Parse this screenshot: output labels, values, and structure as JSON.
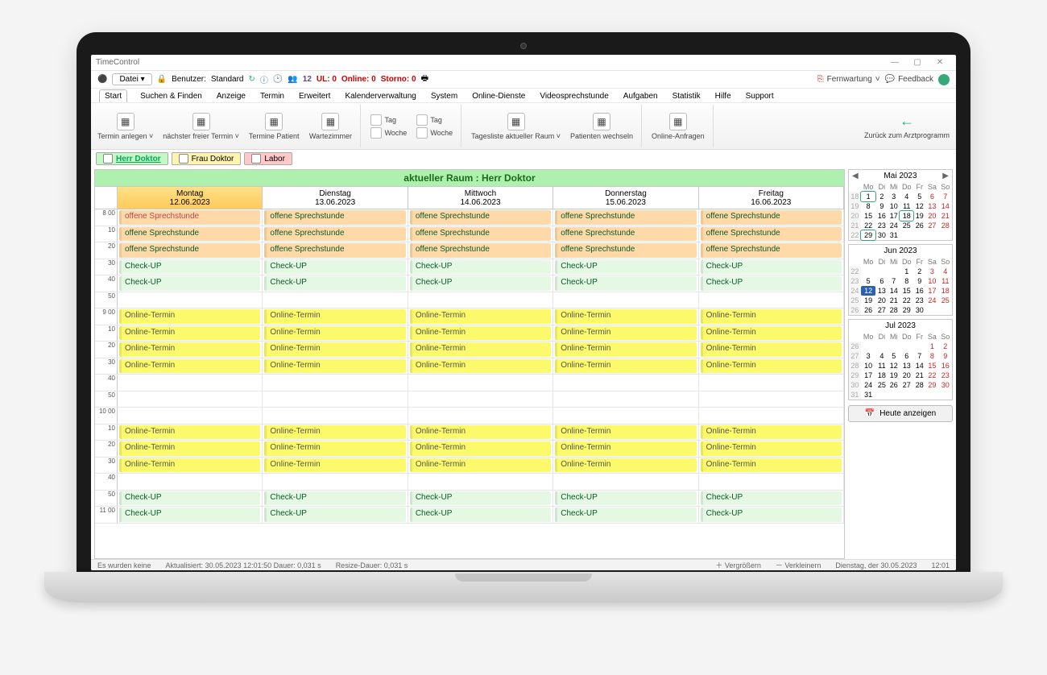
{
  "window": {
    "title": "TimeControl",
    "min": "—",
    "max": "▢",
    "close": "✕"
  },
  "toolbar1": {
    "datei": "Datei ▾",
    "benutzer_label": "Benutzer:",
    "benutzer_value": "Standard",
    "count": "12",
    "ul": "UL: 0",
    "online": "Online: 0",
    "storno": "Storno: 0",
    "fernwartung": "Fernwartung",
    "feedback": "Feedback"
  },
  "menubar": [
    "Start",
    "Suchen & Finden",
    "Anzeige",
    "Termin",
    "Erweitert",
    "Kalenderverwaltung",
    "System",
    "Online-Dienste",
    "Videosprechstunde",
    "Aufgaben",
    "Statistik",
    "Hilfe",
    "Support"
  ],
  "ribbon": {
    "g1": [
      {
        "label": "Termin anlegen",
        "chev": "˅"
      },
      {
        "label": "nächster freier Termin",
        "chev": "˅"
      },
      {
        "label": "Termine Patient"
      },
      {
        "label": "Wartezimmer"
      }
    ],
    "g2rows": [
      "Tag",
      "Woche",
      "Tag",
      "Woche"
    ],
    "g3": [
      {
        "label": "Tagesliste aktueller Raum",
        "chev": "˅"
      },
      {
        "label": "Patienten wechseln"
      }
    ],
    "g4": [
      {
        "label": "Online-Anfragen"
      }
    ],
    "back": "Zurück zum Arztprogramm"
  },
  "rooms": [
    {
      "label": "Herr Doktor",
      "cls": "r-herr"
    },
    {
      "label": "Frau Doktor",
      "cls": "r-frau"
    },
    {
      "label": "Labor",
      "cls": "r-labor"
    }
  ],
  "sched": {
    "header": "aktueller Raum : Herr Doktor",
    "days": [
      {
        "name": "Montag",
        "date": "12.06.2023"
      },
      {
        "name": "Dienstag",
        "date": "13.06.2023"
      },
      {
        "name": "Mittwoch",
        "date": "14.06.2023"
      },
      {
        "name": "Donnerstag",
        "date": "15.06.2023"
      },
      {
        "name": "Freitag",
        "date": "16.06.2023"
      }
    ],
    "rows": [
      {
        "t": "8 00",
        "apts": [
          "offene Sprechstunde",
          "offene Sprechstunde",
          "offene Sprechstunde",
          "offene Sprechstunde",
          "offene Sprechstunde"
        ],
        "firstSpecial": true,
        "cls": "offen2"
      },
      {
        "t": "10",
        "apts": [
          "offene Sprechstunde",
          "offene Sprechstunde",
          "offene Sprechstunde",
          "offene Sprechstunde",
          "offene Sprechstunde"
        ],
        "cls": "offen2"
      },
      {
        "t": "20",
        "apts": [
          "offene Sprechstunde",
          "offene Sprechstunde",
          "offene Sprechstunde",
          "offene Sprechstunde",
          "offene Sprechstunde"
        ],
        "cls": "offen2"
      },
      {
        "t": "30",
        "apts": [
          "Check-UP",
          "Check-UP",
          "Check-UP",
          "Check-UP",
          "Check-UP"
        ],
        "cls": "check"
      },
      {
        "t": "40",
        "apts": [
          "Check-UP",
          "Check-UP",
          "Check-UP",
          "Check-UP",
          "Check-UP"
        ],
        "cls": "check"
      },
      {
        "t": "50",
        "apts": [
          "",
          "",
          "",
          "",
          ""
        ],
        "cls": ""
      },
      {
        "t": "9 00",
        "apts": [
          "Online-Termin",
          "Online-Termin",
          "Online-Termin",
          "Online-Termin",
          "Online-Termin"
        ],
        "cls": "online"
      },
      {
        "t": "10",
        "apts": [
          "Online-Termin",
          "Online-Termin",
          "Online-Termin",
          "Online-Termin",
          "Online-Termin"
        ],
        "cls": "online"
      },
      {
        "t": "20",
        "apts": [
          "Online-Termin",
          "Online-Termin",
          "Online-Termin",
          "Online-Termin",
          "Online-Termin"
        ],
        "cls": "online"
      },
      {
        "t": "30",
        "apts": [
          "Online-Termin",
          "Online-Termin",
          "Online-Termin",
          "Online-Termin",
          "Online-Termin"
        ],
        "cls": "online"
      },
      {
        "t": "40",
        "apts": [
          "",
          "",
          "",
          "",
          ""
        ],
        "cls": ""
      },
      {
        "t": "50",
        "apts": [
          "",
          "",
          "",
          "",
          ""
        ],
        "cls": ""
      },
      {
        "t": "10 00",
        "apts": [
          "",
          "",
          "",
          "",
          ""
        ],
        "cls": ""
      },
      {
        "t": "10",
        "apts": [
          "Online-Termin",
          "Online-Termin",
          "Online-Termin",
          "Online-Termin",
          "Online-Termin"
        ],
        "cls": "online"
      },
      {
        "t": "20",
        "apts": [
          "Online-Termin",
          "Online-Termin",
          "Online-Termin",
          "Online-Termin",
          "Online-Termin"
        ],
        "cls": "online"
      },
      {
        "t": "30",
        "apts": [
          "Online-Termin",
          "Online-Termin",
          "Online-Termin",
          "Online-Termin",
          "Online-Termin"
        ],
        "cls": "online"
      },
      {
        "t": "40",
        "apts": [
          "",
          "",
          "",
          "",
          ""
        ],
        "cls": ""
      },
      {
        "t": "50",
        "apts": [
          "Check-UP",
          "Check-UP",
          "Check-UP",
          "Check-UP",
          "Check-UP"
        ],
        "cls": "check"
      },
      {
        "t": "11 00",
        "apts": [
          "Check-UP",
          "Check-UP",
          "Check-UP",
          "Check-UP",
          "Check-UP"
        ],
        "cls": "check"
      }
    ]
  },
  "minicals": [
    {
      "title": "Mai 2023",
      "showArrows": true,
      "dow": [
        "Mo",
        "Di",
        "Mi",
        "Do",
        "Fr",
        "Sa",
        "So"
      ],
      "weeks": [
        {
          "wk": 18,
          "d": [
            1,
            2,
            3,
            4,
            5,
            6,
            7
          ],
          "mark": [
            1
          ]
        },
        {
          "wk": 19,
          "d": [
            8,
            9,
            10,
            11,
            12,
            13,
            14
          ]
        },
        {
          "wk": 20,
          "d": [
            15,
            16,
            17,
            18,
            19,
            20,
            21
          ],
          "mark": [
            18
          ]
        },
        {
          "wk": 21,
          "d": [
            22,
            23,
            24,
            25,
            26,
            27,
            28
          ]
        },
        {
          "wk": 22,
          "d": [
            29,
            30,
            31,
            "",
            "",
            "",
            ""
          ],
          "mark": [
            29
          ]
        }
      ]
    },
    {
      "title": "Jun 2023",
      "showArrows": false,
      "dow": [
        "Mo",
        "Di",
        "Mi",
        "Do",
        "Fr",
        "Sa",
        "So"
      ],
      "weeks": [
        {
          "wk": 22,
          "d": [
            "",
            "",
            "",
            1,
            2,
            3,
            4
          ]
        },
        {
          "wk": 23,
          "d": [
            5,
            6,
            7,
            8,
            9,
            10,
            11
          ]
        },
        {
          "wk": 24,
          "d": [
            12,
            13,
            14,
            15,
            16,
            17,
            18
          ],
          "today": 12
        },
        {
          "wk": 25,
          "d": [
            19,
            20,
            21,
            22,
            23,
            24,
            25
          ]
        },
        {
          "wk": 26,
          "d": [
            26,
            27,
            28,
            29,
            30,
            "",
            ""
          ]
        }
      ]
    },
    {
      "title": "Jul 2023",
      "showArrows": false,
      "dow": [
        "Mo",
        "Di",
        "Mi",
        "Do",
        "Fr",
        "Sa",
        "So"
      ],
      "weeks": [
        {
          "wk": 26,
          "d": [
            "",
            "",
            "",
            "",
            "",
            1,
            2
          ]
        },
        {
          "wk": 27,
          "d": [
            3,
            4,
            5,
            6,
            7,
            8,
            9
          ]
        },
        {
          "wk": 28,
          "d": [
            10,
            11,
            12,
            13,
            14,
            15,
            16
          ]
        },
        {
          "wk": 29,
          "d": [
            17,
            18,
            19,
            20,
            21,
            22,
            23
          ]
        },
        {
          "wk": 30,
          "d": [
            24,
            25,
            26,
            27,
            28,
            29,
            30
          ]
        },
        {
          "wk": 31,
          "d": [
            31,
            "",
            "",
            "",
            "",
            "",
            ""
          ]
        }
      ]
    }
  ],
  "heute": "Heute anzeigen",
  "status": {
    "left": "Es wurden keine",
    "mid": "Aktualisiert: 30.05.2023 12:01:50 Dauer: 0,031 s",
    "resize": "Resize-Dauer: 0,031 s",
    "zoomin": "＋ Vergrößern",
    "zoomout": "－ Verkleinern",
    "date": "Dienstag, der 30.05.2023",
    "time": "12:01"
  }
}
